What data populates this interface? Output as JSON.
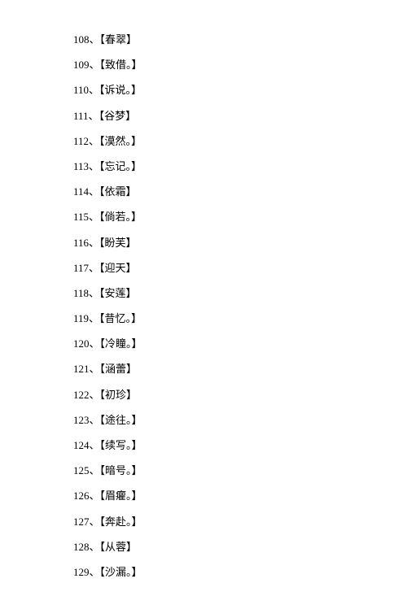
{
  "items": [
    {
      "number": "108",
      "separator": "、",
      "text": "【春翠】"
    },
    {
      "number": "109",
      "separator": "、",
      "text": "【致借。】"
    },
    {
      "number": "110",
      "separator": "、",
      "text": "【诉说。】"
    },
    {
      "number": "111",
      "separator": "、",
      "text": "【谷梦】"
    },
    {
      "number": "112",
      "separator": "、",
      "text": "【漠然。】"
    },
    {
      "number": "113",
      "separator": "、",
      "text": "【忘记。】"
    },
    {
      "number": "114",
      "separator": "、",
      "text": "【依霜】"
    },
    {
      "number": "115",
      "separator": "、",
      "text": "【倘若。】"
    },
    {
      "number": "116",
      "separator": "、",
      "text": "【盼芙】"
    },
    {
      "number": "117",
      "separator": "、",
      "text": "【迎天】"
    },
    {
      "number": "118",
      "separator": "、",
      "text": "【安莲】"
    },
    {
      "number": "119",
      "separator": "、",
      "text": "【昔忆。】"
    },
    {
      "number": "120",
      "separator": "、",
      "text": "【冷瞳。】"
    },
    {
      "number": "121",
      "separator": "、",
      "text": "【涵蕾】"
    },
    {
      "number": "122",
      "separator": "、",
      "text": "【初珍】"
    },
    {
      "number": "123",
      "separator": "、",
      "text": "【途往。】"
    },
    {
      "number": "124",
      "separator": "、",
      "text": "【续写。】"
    },
    {
      "number": "125",
      "separator": "、",
      "text": "【暗号。】"
    },
    {
      "number": "126",
      "separator": "、",
      "text": "【眉癯。】"
    },
    {
      "number": "127",
      "separator": "、",
      "text": "【奔赴。】"
    },
    {
      "number": "128",
      "separator": "、",
      "text": "【从蓉】"
    },
    {
      "number": "129",
      "separator": "、",
      "text": "【沙漏。】"
    }
  ]
}
